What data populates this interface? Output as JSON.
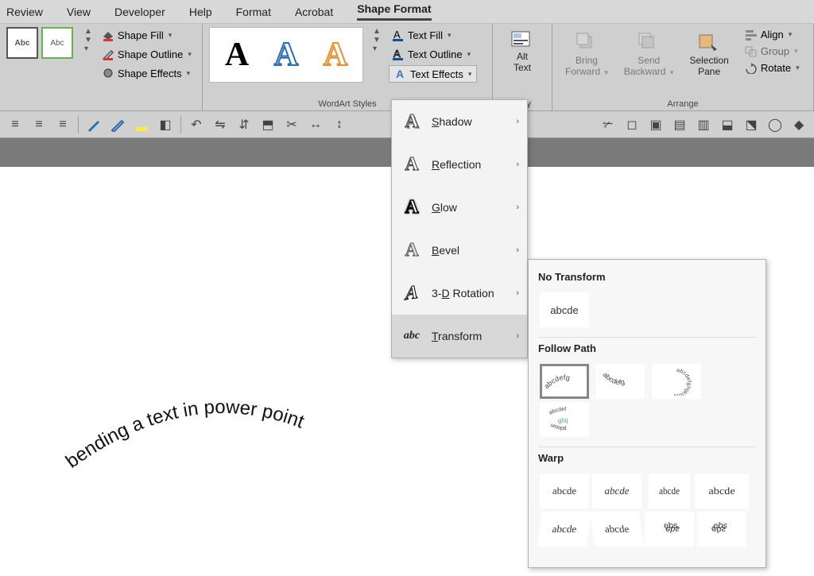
{
  "menubar": {
    "items": [
      "Review",
      "View",
      "Developer",
      "Help",
      "Format",
      "Acrobat",
      "Shape Format"
    ],
    "active_index": 6
  },
  "ribbon": {
    "shape_styles": {
      "thumb_label": "Abc",
      "buttons": [
        "Shape Fill",
        "Shape Outline",
        "Shape Effects"
      ]
    },
    "wordart": {
      "label": "WordArt Styles",
      "text_buttons": [
        "Text Fill",
        "Text Outline",
        "Text Effects"
      ]
    },
    "bility_label": "bility",
    "alt_text": {
      "line1": "Alt",
      "line2": "Text"
    },
    "arrange": {
      "label": "Arrange",
      "bring_forward": {
        "line1": "Bring",
        "line2": "Forward"
      },
      "send_backward": {
        "line1": "Send",
        "line2": "Backward"
      },
      "selection_pane": {
        "line1": "Selection",
        "line2": "Pane"
      },
      "align": "Align",
      "group": "Group",
      "rotate": "Rotate"
    }
  },
  "text_effects_menu": {
    "items": [
      "Shadow",
      "Reflection",
      "Glow",
      "Bevel",
      "3-D Rotation",
      "Transform"
    ]
  },
  "transform_panel": {
    "no_transform": {
      "title": "No Transform",
      "sample": "abcde"
    },
    "follow_path": {
      "title": "Follow Path"
    },
    "warp": {
      "title": "Warp",
      "sample": "abcde"
    }
  },
  "slide": {
    "curved_text": "bending a text in power point"
  }
}
